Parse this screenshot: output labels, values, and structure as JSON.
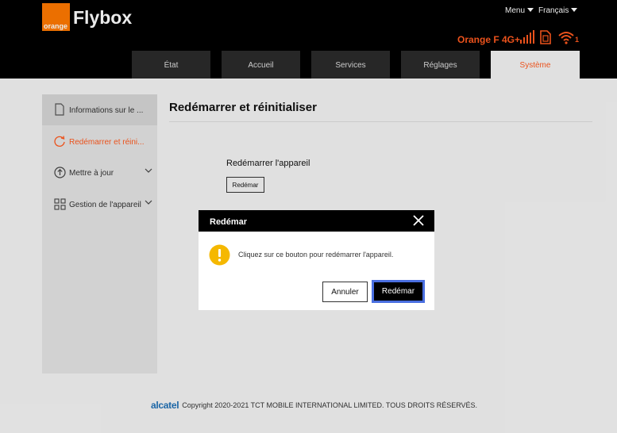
{
  "brand": {
    "logo_text": "orange",
    "product": "Flybox",
    "logo_color": "#ff7900"
  },
  "top_menu": {
    "menu_label": "Menu",
    "language_label": "Français"
  },
  "status": {
    "operator": "Orange F 4G+",
    "wifi_clients": "1",
    "accent": "#ff5a1f",
    "icons": [
      "signal-bars-icon",
      "sim-card-icon",
      "wifi-icon"
    ]
  },
  "tabs": [
    {
      "label": "État"
    },
    {
      "label": "Accueil"
    },
    {
      "label": "Services"
    },
    {
      "label": "Réglages"
    },
    {
      "label": "Système",
      "active": true
    }
  ],
  "sidebar": {
    "items": [
      {
        "label": "Informations sur le ...",
        "icon": "document-icon"
      },
      {
        "label": "Redémarrer et réini...",
        "icon": "restart-icon",
        "active": true
      },
      {
        "label": "Mettre à jour",
        "icon": "upload-icon",
        "expandable": true
      },
      {
        "label": "Gestion de l'appareil",
        "icon": "grid-icon",
        "expandable": true
      }
    ]
  },
  "main": {
    "title": "Redémarrer et réinitialiser",
    "section_label": "Redémarrer l'appareil",
    "restart_button": "Redémar"
  },
  "footer": {
    "brand": "alcatel",
    "copyright": "Copyright 2020-2021 TCT MOBILE INTERNATIONAL LIMITED. TOUS DROITS RÉSERVÉS."
  },
  "dialog": {
    "title": "Redémar",
    "message": "Cliquez sur ce bouton pour redémarrer l'appareil.",
    "cancel_label": "Annuler",
    "confirm_label": "Redémar",
    "warning_color": "#f5b800"
  }
}
